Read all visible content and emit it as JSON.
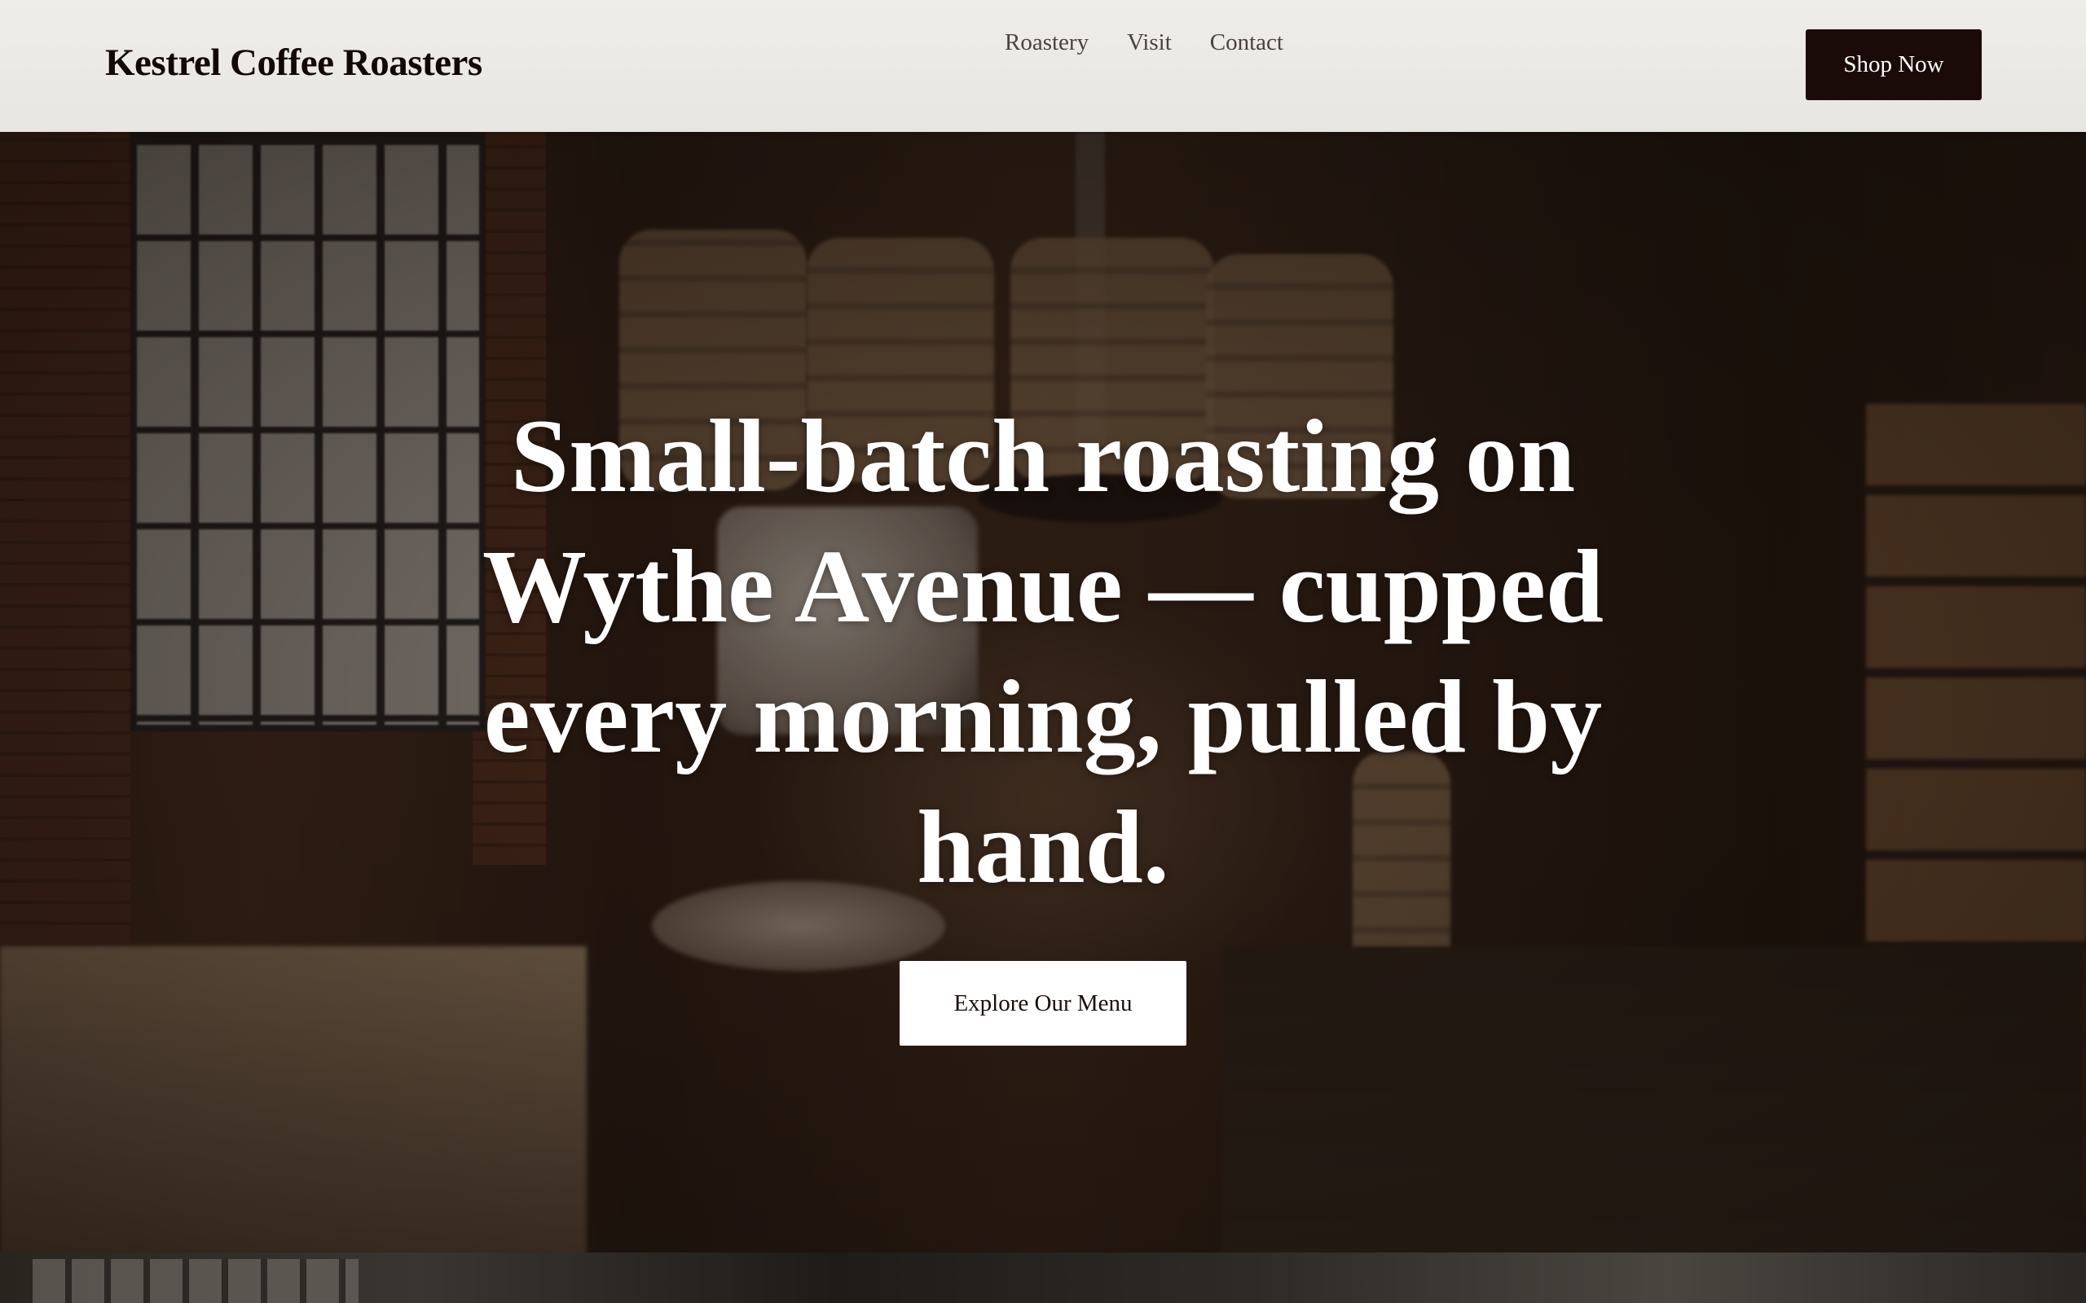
{
  "header": {
    "logo": "Kestrel Coffee Roasters",
    "nav": [
      "Roastery",
      "Visit",
      "Contact"
    ],
    "shop_button": "Shop Now"
  },
  "hero": {
    "headline": "Small-batch roasting on Wythe Avenue — cupped every morning, pulled by hand.",
    "cta_label": "Explore Our Menu",
    "background_image": "coffee roastery interior with burlap sacks, drum roaster, and shelves of bagged beans"
  },
  "colors": {
    "header_bg": "#efede8",
    "shop_button_bg": "#1b0b08",
    "headline": "#ffffff",
    "cta_bg": "#ffffff"
  }
}
